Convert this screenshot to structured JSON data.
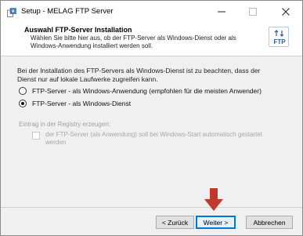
{
  "window": {
    "title": "Setup - MELAG FTP Server",
    "app_icon": "installer-icon",
    "controls": {
      "minimize": "minimize-icon",
      "maximize": "maximize-icon",
      "close": "close-icon"
    }
  },
  "header": {
    "title": "Auswahl FTP-Server Installation",
    "description": "Wählen Sie bitte hier aus, ob der FTP-Server als Windows-Dienst oder als Windows-Anwendung installiert werden soll.",
    "logo_text": "FTP",
    "logo_icon": "ftp-transfer-icon"
  },
  "body": {
    "info_text": "Bei der Installation des FTP-Servers als Windows-Dienst ist zu beachten, dass der Dienst nur auf lokale Laufwerke zugreifen kann.",
    "options": [
      {
        "label": "FTP-Server - als Windows-Anwendung (empfohlen für die meisten Anwender)",
        "checked": false
      },
      {
        "label": "FTP-Server - als Windows-Dienst",
        "checked": true
      }
    ],
    "registry_label": "Eintrag in der Registry erzeugen:",
    "registry_checkbox_label": "der FTP-Server (als Anwendung) soll bei Windows-Start automatisch gestartet werden",
    "registry_checkbox_checked": false,
    "registry_enabled": false
  },
  "buttons": {
    "back": "< Zurück",
    "next": "Weiter >",
    "cancel": "Abbrechen"
  },
  "annotation": {
    "arrow_color": "#c0392b",
    "arrow_icon": "down-arrow-icon"
  }
}
